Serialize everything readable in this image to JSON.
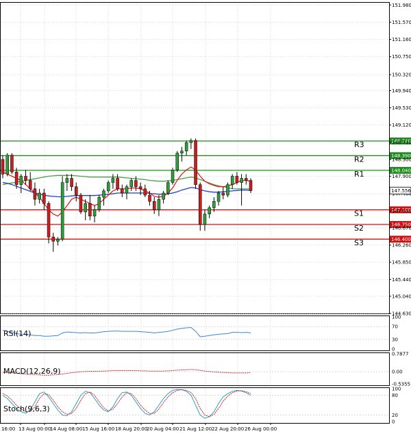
{
  "colors": {
    "grid": "#d8d8d8",
    "frame": "#000000",
    "bull": "#2f9e3a",
    "bear": "#c8201e",
    "ma_red": "#e02020",
    "ma_green": "#4aa04a",
    "ma_blue": "#2040c0",
    "rsi": "#3b86d8",
    "macd": "#c03030",
    "stoch_main": "#2aa0c8",
    "stoch_signal": "#d02020",
    "resistance": "#1f8a1f",
    "support": "#d01010",
    "current_bg": "#ffffff"
  },
  "chart_data": {
    "type": "candlestick",
    "price_scale": {
      "ticks": [
        "151.980",
        "151.570",
        "151.160",
        "150.750",
        "150.320",
        "149.940",
        "149.530",
        "149.120",
        "148.710",
        "148.300",
        "147.900",
        "147.480",
        "147.070",
        "146.670",
        "146.260",
        "145.850",
        "145.440",
        "145.040",
        "144.630"
      ],
      "range": [
        144.63,
        152.05
      ]
    },
    "x_labels": [
      "16:00",
      "13 Aug 00:00",
      "14 Aug 08:00",
      "15 Aug 16:00",
      "18 Aug 20:00",
      "20 Aug 04:00",
      "21 Aug 12:00",
      "22 Aug 20:00",
      "26 Aug 00:00"
    ],
    "levels": [
      {
        "name": "R3",
        "price": "148.740",
        "value": 148.74,
        "kind": "resistance"
      },
      {
        "name": "R2",
        "price": "148.390",
        "value": 148.39,
        "kind": "resistance"
      },
      {
        "name": "R1",
        "price": "148.040",
        "value": 148.04,
        "kind": "resistance"
      },
      {
        "name": "S1",
        "price": "147.100",
        "value": 147.1,
        "kind": "support"
      },
      {
        "name": "S2",
        "price": "146.750",
        "value": 146.75,
        "kind": "support"
      },
      {
        "name": "S3",
        "price": "146.400",
        "value": 146.4,
        "kind": "support"
      }
    ],
    "current_price": {
      "label": "147.556",
      "value": 147.556
    },
    "candles": [
      [
        148.3,
        148.4,
        147.85,
        147.95
      ],
      [
        147.95,
        148.45,
        147.9,
        148.4
      ],
      [
        148.4,
        148.45,
        147.95,
        148.0
      ],
      [
        148.0,
        148.1,
        147.6,
        147.7
      ],
      [
        147.7,
        147.95,
        147.5,
        147.9
      ],
      [
        147.9,
        148.05,
        147.7,
        147.8
      ],
      [
        147.8,
        148.0,
        147.55,
        147.6
      ],
      [
        147.6,
        147.75,
        147.2,
        147.35
      ],
      [
        147.35,
        147.6,
        147.25,
        147.5
      ],
      [
        147.5,
        147.6,
        147.1,
        147.25
      ],
      [
        147.25,
        147.3,
        146.3,
        146.45
      ],
      [
        146.45,
        146.55,
        146.1,
        146.35
      ],
      [
        146.35,
        146.45,
        146.25,
        146.4
      ],
      [
        146.4,
        147.9,
        146.35,
        147.75
      ],
      [
        147.75,
        147.95,
        147.55,
        147.85
      ],
      [
        147.85,
        147.95,
        147.55,
        147.65
      ],
      [
        147.65,
        147.75,
        147.3,
        147.45
      ],
      [
        147.45,
        147.5,
        147.0,
        147.05
      ],
      [
        147.05,
        147.35,
        146.85,
        147.25
      ],
      [
        147.25,
        147.45,
        146.85,
        146.95
      ],
      [
        146.95,
        147.2,
        146.8,
        147.1
      ],
      [
        147.1,
        147.45,
        147.05,
        147.4
      ],
      [
        147.4,
        147.6,
        147.2,
        147.55
      ],
      [
        147.55,
        147.8,
        147.5,
        147.75
      ],
      [
        147.75,
        147.95,
        147.6,
        147.85
      ],
      [
        147.85,
        147.95,
        147.55,
        147.6
      ],
      [
        147.6,
        147.7,
        147.4,
        147.5
      ],
      [
        147.5,
        147.7,
        147.35,
        147.65
      ],
      [
        147.65,
        147.85,
        147.55,
        147.8
      ],
      [
        147.8,
        147.9,
        147.55,
        147.65
      ],
      [
        147.65,
        147.75,
        147.45,
        147.6
      ],
      [
        147.6,
        147.7,
        147.4,
        147.45
      ],
      [
        147.45,
        147.55,
        147.2,
        147.3
      ],
      [
        147.3,
        147.4,
        147.0,
        147.1
      ],
      [
        147.1,
        147.45,
        146.95,
        147.35
      ],
      [
        147.35,
        147.55,
        147.25,
        147.5
      ],
      [
        147.5,
        147.8,
        147.45,
        147.75
      ],
      [
        147.75,
        148.1,
        147.7,
        148.05
      ],
      [
        148.05,
        148.5,
        148.0,
        148.45
      ],
      [
        148.45,
        148.6,
        148.25,
        148.5
      ],
      [
        148.5,
        148.75,
        148.4,
        148.7
      ],
      [
        148.7,
        148.8,
        148.55,
        148.75
      ],
      [
        148.75,
        148.8,
        147.6,
        147.7
      ],
      [
        147.7,
        147.75,
        146.6,
        146.75
      ],
      [
        146.75,
        147.1,
        146.6,
        147.0
      ],
      [
        147.0,
        147.2,
        146.9,
        147.15
      ],
      [
        147.15,
        147.4,
        147.05,
        147.3
      ],
      [
        147.3,
        147.55,
        147.2,
        147.5
      ],
      [
        147.5,
        147.65,
        147.35,
        147.45
      ],
      [
        147.45,
        147.75,
        147.4,
        147.7
      ],
      [
        147.7,
        147.95,
        147.6,
        147.9
      ],
      [
        147.9,
        148.0,
        147.7,
        147.75
      ],
      [
        147.75,
        147.95,
        147.2,
        147.85
      ],
      [
        147.85,
        147.95,
        147.7,
        147.8
      ],
      [
        147.8,
        147.85,
        147.5,
        147.556
      ]
    ],
    "ma_red": [
      148.0,
      147.95,
      147.9,
      147.85,
      147.8,
      147.7,
      147.6,
      147.5,
      147.4,
      147.25,
      147.1,
      147.0,
      146.95,
      147.05,
      147.2,
      147.35,
      147.4,
      147.35,
      147.3,
      147.25,
      147.2,
      147.25,
      147.35,
      147.45,
      147.55,
      147.6,
      147.6,
      147.6,
      147.62,
      147.62,
      147.6,
      147.55,
      147.5,
      147.42,
      147.4,
      147.42,
      147.5,
      147.62,
      147.8,
      147.95,
      148.05,
      148.12,
      148.05,
      147.9,
      147.78,
      147.72,
      147.68,
      147.65,
      147.65,
      147.67,
      147.7,
      147.75,
      147.8,
      147.8,
      147.78
    ],
    "ma_green": [
      147.7,
      147.72,
      147.74,
      147.76,
      147.78,
      147.8,
      147.82,
      147.84,
      147.86,
      147.88,
      147.9,
      147.91,
      147.92,
      147.92,
      147.92,
      147.92,
      147.91,
      147.9,
      147.89,
      147.88,
      147.88,
      147.88,
      147.88,
      147.88,
      147.88,
      147.88,
      147.87,
      147.86,
      147.85,
      147.84,
      147.83,
      147.82,
      147.8,
      147.79,
      147.78,
      147.78,
      147.79,
      147.8,
      147.82,
      147.84,
      147.86,
      147.88,
      147.86,
      147.82,
      147.78,
      147.74,
      147.7,
      147.67,
      147.65,
      147.63,
      147.6,
      147.6,
      147.6,
      147.6,
      147.6
    ],
    "ma_blue": [
      147.75,
      147.73,
      147.7,
      147.66,
      147.62,
      147.58,
      147.54,
      147.5,
      147.47,
      147.45,
      147.43,
      147.42,
      147.41,
      147.41,
      147.42,
      147.43,
      147.44,
      147.44,
      147.44,
      147.44,
      147.44,
      147.45,
      147.46,
      147.47,
      147.48,
      147.5,
      147.5,
      147.5,
      147.5,
      147.5,
      147.5,
      147.5,
      147.49,
      147.48,
      147.47,
      147.47,
      147.48,
      147.5,
      147.53,
      147.57,
      147.6,
      147.63,
      147.62,
      147.58,
      147.55,
      147.53,
      147.52,
      147.52,
      147.53,
      147.54,
      147.55,
      147.56,
      147.57,
      147.57,
      147.56
    ],
    "rsi": {
      "label": "RSI(14)",
      "ticks": [
        "100",
        "70",
        "30",
        "0"
      ],
      "values": [
        58,
        55,
        52,
        48,
        46,
        45,
        44,
        42,
        42,
        40,
        40,
        41,
        42,
        50,
        53,
        52,
        51,
        50,
        51,
        50,
        50,
        52,
        54,
        55,
        56,
        56,
        55,
        55,
        55,
        55,
        54,
        53,
        52,
        50,
        52,
        53,
        55,
        58,
        62,
        64,
        66,
        67,
        55,
        38,
        40,
        42,
        44,
        46,
        47,
        48,
        52,
        52,
        51,
        52,
        50
      ]
    },
    "macd": {
      "label": "MACD(12,26,9)",
      "ticks": [
        "0.7877",
        "0.00",
        "-0.5355"
      ],
      "values": [
        -0.02,
        -0.03,
        -0.05,
        -0.07,
        -0.09,
        -0.1,
        -0.12,
        -0.13,
        -0.14,
        -0.15,
        -0.15,
        -0.14,
        -0.12,
        -0.1,
        -0.07,
        -0.04,
        -0.02,
        0.0,
        0.01,
        0.02,
        0.02,
        0.02,
        0.03,
        0.04,
        0.05,
        0.05,
        0.05,
        0.05,
        0.05,
        0.05,
        0.04,
        0.04,
        0.03,
        0.03,
        0.03,
        0.03,
        0.04,
        0.05,
        0.07,
        0.08,
        0.09,
        0.1,
        0.09,
        0.06,
        0.03,
        0.01,
        -0.01,
        -0.02,
        -0.03,
        -0.04,
        -0.05,
        -0.05,
        -0.05,
        -0.05,
        -0.04
      ]
    },
    "stoch": {
      "label": "Stoch(9,6,3)",
      "ticks": [
        "100",
        "80",
        "20",
        "0"
      ],
      "main": [
        80,
        70,
        55,
        40,
        30,
        25,
        35,
        60,
        85,
        90,
        75,
        55,
        35,
        20,
        18,
        30,
        55,
        80,
        92,
        88,
        70,
        50,
        35,
        30,
        45,
        70,
        88,
        90,
        80,
        60,
        40,
        25,
        20,
        30,
        50,
        70,
        85,
        95,
        98,
        97,
        92,
        80,
        50,
        20,
        10,
        15,
        30,
        55,
        75,
        85,
        92,
        95,
        93,
        88,
        80
      ],
      "signal": [
        85,
        78,
        65,
        50,
        38,
        30,
        30,
        45,
        70,
        85,
        82,
        65,
        45,
        30,
        22,
        25,
        40,
        65,
        85,
        90,
        80,
        60,
        42,
        32,
        38,
        55,
        75,
        88,
        85,
        70,
        50,
        35,
        25,
        25,
        38,
        58,
        75,
        88,
        95,
        97,
        95,
        88,
        70,
        40,
        20,
        15,
        22,
        40,
        62,
        78,
        88,
        93,
        94,
        91,
        85
      ]
    }
  }
}
